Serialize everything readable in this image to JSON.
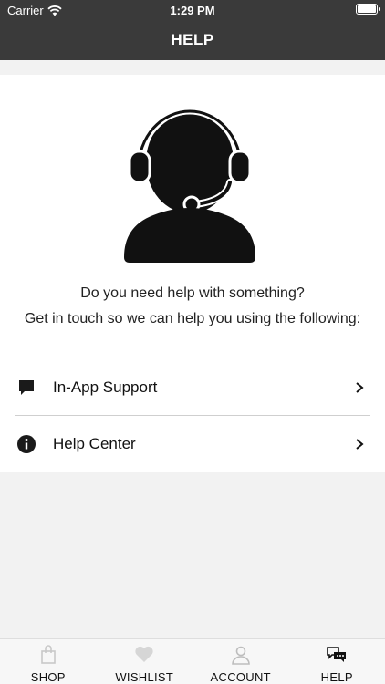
{
  "status_bar": {
    "carrier": "Carrier",
    "time": "1:29 PM"
  },
  "header": {
    "title": "HELP"
  },
  "main": {
    "message_line1": "Do you need help with something?",
    "message_line2": "Get in touch so we can help you using the following:",
    "options": [
      {
        "label": "In-App Support",
        "icon": "chat-bubble-icon"
      },
      {
        "label": "Help Center",
        "icon": "info-icon"
      }
    ]
  },
  "tabbar": {
    "tabs": [
      {
        "label": "SHOP",
        "icon": "shopping-bag-icon"
      },
      {
        "label": "WISHLIST",
        "icon": "heart-icon"
      },
      {
        "label": "ACCOUNT",
        "icon": "user-icon"
      },
      {
        "label": "HELP",
        "icon": "chat-bubbles-icon",
        "active": true
      }
    ]
  },
  "colors": {
    "header_bg": "#3a3a3a",
    "page_bg": "#f2f2f2",
    "card_bg": "#ffffff",
    "icon_dark": "#111111",
    "tab_inactive": "#c8c8c8"
  }
}
